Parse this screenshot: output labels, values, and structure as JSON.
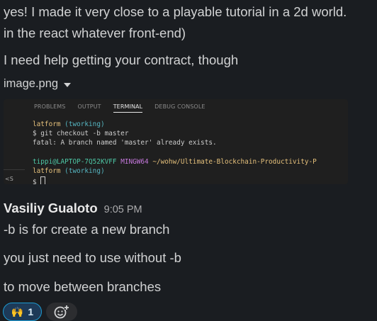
{
  "messages_prev": {
    "line1": "yes! I made it very close to a playable tutorial in a 2d world.",
    "line2": "in the react whatever front-end)",
    "line3": "I need help getting your contract, though"
  },
  "attachment": {
    "filename": "image.png",
    "screenshot": {
      "tabs": [
        "PROBLEMS",
        "OUTPUT",
        "TERMINAL",
        "DEBUG CONSOLE"
      ],
      "active_tab": "TERMINAL",
      "side_label": "<S",
      "terminal": {
        "l1_prefix": "latform",
        "l1_branch": "(tworking)",
        "l2": "$ git checkout -b master",
        "l3": "fatal: A branch named 'master' already exists.",
        "l5_host": "tippi@LAPTOP-7Q52KVFF",
        "l5_env": "MINGW64",
        "l5_path": "~/wohw/Ultimate-Blockchain-Productivity-P",
        "l6_prefix": "latform",
        "l6_branch": "(tworking)",
        "l7": "$ "
      }
    }
  },
  "message": {
    "author": "Vasiliy Gualoto",
    "time": "9:05 PM",
    "lines": [
      "-b is for create a new branch",
      "you just need to use without -b",
      "to move between branches"
    ]
  },
  "reactions": [
    {
      "emoji": "🙌",
      "count": "1"
    }
  ],
  "add_reaction_icon": "add-reaction-icon",
  "colors": {
    "background": "#1a1d21",
    "reaction_border": "#1d9bd1",
    "terminal_bg": "#1f1f1f"
  }
}
